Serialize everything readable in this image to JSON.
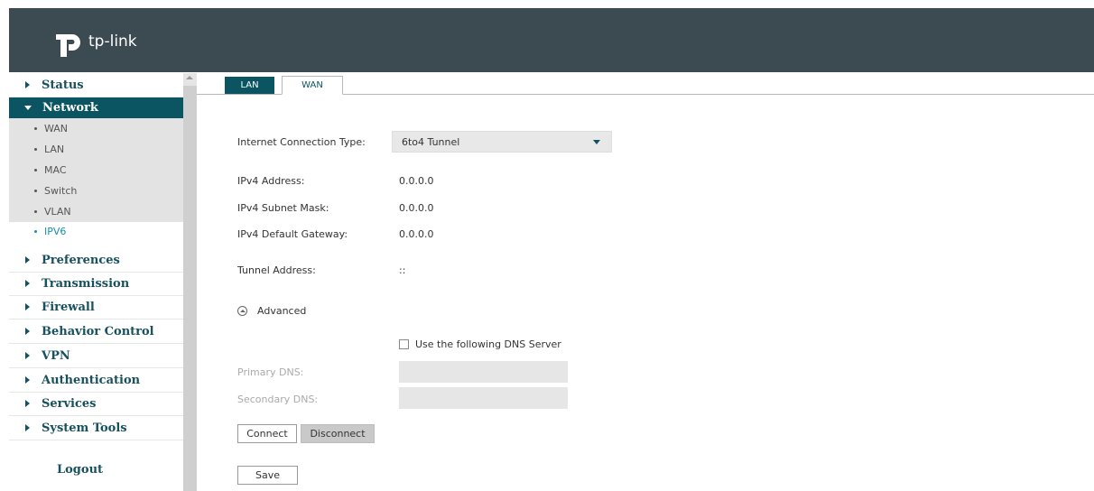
{
  "brand": {
    "name": "tp-link"
  },
  "nav": {
    "items": [
      {
        "label": "Status"
      },
      {
        "label": "Network"
      },
      {
        "label": "Preferences"
      },
      {
        "label": "Transmission"
      },
      {
        "label": "Firewall"
      },
      {
        "label": "Behavior Control"
      },
      {
        "label": "VPN"
      },
      {
        "label": "Authentication"
      },
      {
        "label": "Services"
      },
      {
        "label": "System Tools"
      }
    ],
    "network_sub": [
      {
        "label": "WAN"
      },
      {
        "label": "LAN"
      },
      {
        "label": "MAC"
      },
      {
        "label": "Switch"
      },
      {
        "label": "VLAN"
      },
      {
        "label": "IPV6"
      }
    ],
    "logout": "Logout"
  },
  "tabs": [
    {
      "label": "LAN"
    },
    {
      "label": "WAN"
    }
  ],
  "form": {
    "connection_type_label": "Internet Connection Type:",
    "connection_type_value": "6to4 Tunnel",
    "ipv4_address_label": "IPv4 Address:",
    "ipv4_address_value": "0.0.0.0",
    "ipv4_mask_label": "IPv4 Subnet Mask:",
    "ipv4_mask_value": "0.0.0.0",
    "ipv4_gateway_label": "IPv4 Default Gateway:",
    "ipv4_gateway_value": "0.0.0.0",
    "tunnel_label": "Tunnel Address:",
    "tunnel_value": "::",
    "advanced_label": "Advanced",
    "dns_checkbox_label": "Use the following DNS Server",
    "primary_dns_label": "Primary DNS:",
    "secondary_dns_label": "Secondary DNS:",
    "connect_label": "Connect",
    "disconnect_label": "Disconnect",
    "save_label": "Save"
  }
}
